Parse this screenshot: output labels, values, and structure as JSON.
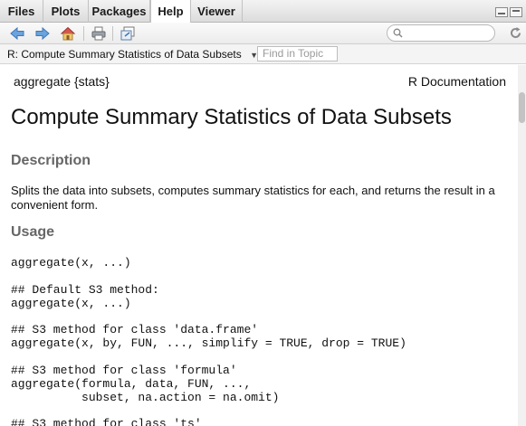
{
  "tabs": [
    {
      "label": "Files"
    },
    {
      "label": "Plots"
    },
    {
      "label": "Packages"
    },
    {
      "label": "Help"
    },
    {
      "label": "Viewer"
    }
  ],
  "toolbar": {
    "search_placeholder": ""
  },
  "topic": {
    "selected": "R: Compute Summary Statistics of Data Subsets",
    "find_placeholder": "Find in Topic"
  },
  "doc": {
    "header_left": "aggregate {stats}",
    "header_right": "R Documentation",
    "title": "Compute Summary Statistics of Data Subsets",
    "sections": {
      "description_heading": "Description",
      "description_text": "Splits the data into subsets, computes summary statistics for each, and returns the result in a convenient form.",
      "usage_heading": "Usage"
    },
    "usage_code": [
      "aggregate(x, ...)",
      "## Default S3 method:\naggregate(x, ...)",
      "## S3 method for class 'data.frame'\naggregate(x, by, FUN, ..., simplify = TRUE, drop = TRUE)",
      "## S3 method for class 'formula'\naggregate(formula, data, FUN, ...,\n          subset, na.action = na.omit)",
      "## S3 method for class 'ts'"
    ]
  }
}
